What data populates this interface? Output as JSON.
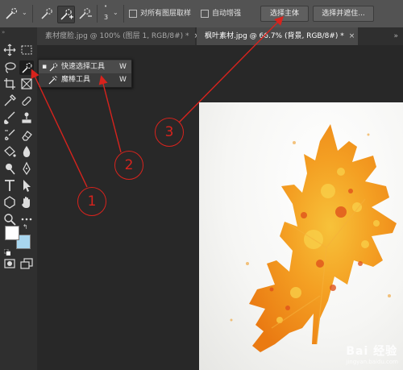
{
  "options_bar": {
    "brush_size": "3",
    "sample_all_layers_label": "对所有图层取样",
    "auto_enhance_label": "自动增强",
    "select_subject_label": "选择主体",
    "select_mask_label": "选择并遮住..."
  },
  "tabs": [
    {
      "label": "素材瘦脸.jpg @ 100% (图层 1, RGB/8#) *",
      "close": "×"
    },
    {
      "label": "枫叶素材.jpg @ 66.7% (背景, RGB/8#) *",
      "close": "×"
    }
  ],
  "flyout": {
    "items": [
      {
        "label": "快速选择工具",
        "shortcut": "W",
        "marker": "▪"
      },
      {
        "label": "魔棒工具",
        "shortcut": "W",
        "marker": ""
      }
    ]
  },
  "annotations": {
    "circle_1": "1",
    "circle_2": "2",
    "circle_3": "3"
  },
  "watermark": {
    "text": "Bai 经验",
    "sub": "jingyan.baidu.com"
  },
  "colors": {
    "annotation_red": "#d8231d",
    "leaf_orange": "#f08a1a",
    "leaf_yellow": "#f7b52c",
    "background_swatch": "#a8d6ef"
  }
}
